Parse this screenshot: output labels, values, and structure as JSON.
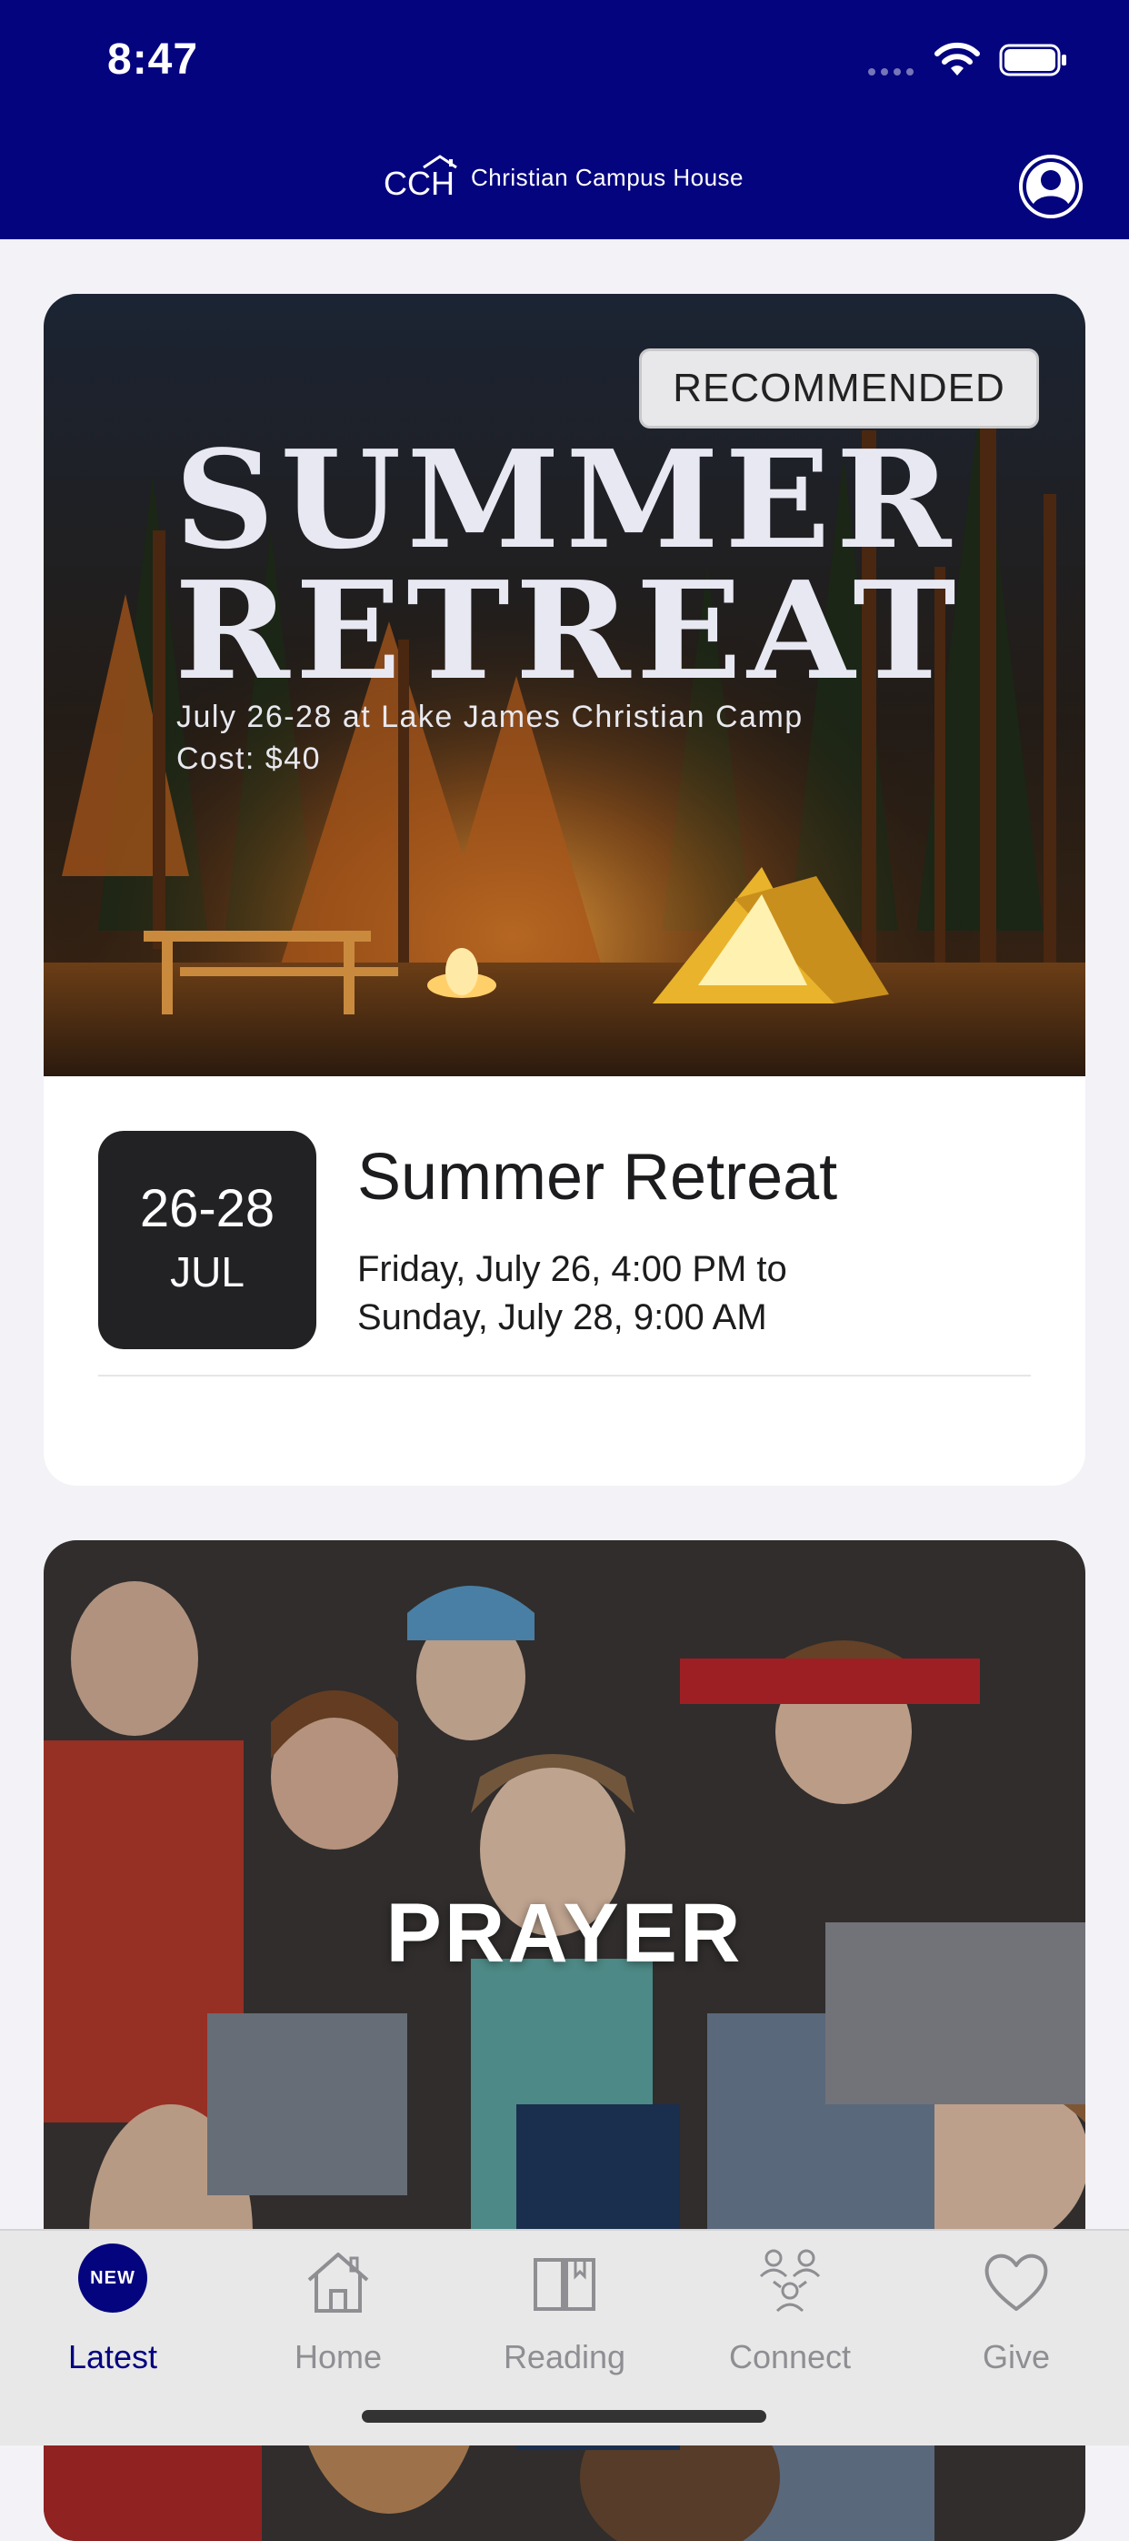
{
  "status_bar": {
    "time": "8:47"
  },
  "header": {
    "logo_text": "CCH",
    "app_name": "Christian Campus House",
    "profile_icon": "person-circle-icon"
  },
  "feed": {
    "retreat": {
      "badge": "RECOMMENDED",
      "hero_title_line1": "SUMMER",
      "hero_title_line2": "RETREAT",
      "hero_subtitle_line1": "July 26-28 at Lake James Christian Camp",
      "hero_subtitle_line2": "Cost: $40",
      "date_range": "26-28",
      "date_month": "JUL",
      "title": "Summer Retreat",
      "time_line1": "Friday, July 26, 4:00 PM to",
      "time_line2": "Sunday, July 28, 9:00 AM"
    },
    "prayer": {
      "title": "PRAYER"
    }
  },
  "tabbar": {
    "tabs": [
      {
        "label": "Latest",
        "icon": "new-badge-icon",
        "badge": "NEW",
        "active": true
      },
      {
        "label": "Home",
        "icon": "house-icon",
        "active": false
      },
      {
        "label": "Reading",
        "icon": "book-icon",
        "active": false
      },
      {
        "label": "Connect",
        "icon": "people-icon",
        "active": false
      },
      {
        "label": "Give",
        "icon": "heart-icon",
        "active": false
      }
    ]
  },
  "colors": {
    "brand_navy": "#05047f",
    "page_background": "#f2f2f7",
    "date_box": "#222225",
    "tab_inactive": "#8e8e93"
  }
}
